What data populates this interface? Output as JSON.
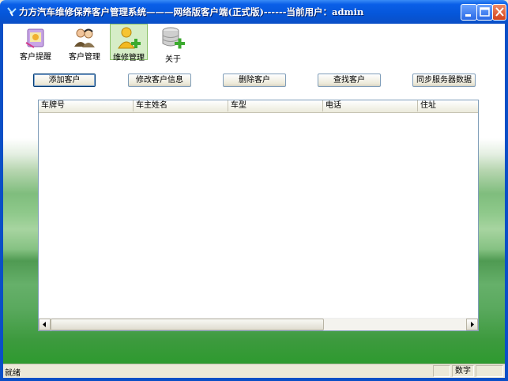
{
  "window": {
    "title": "力方汽车维修保养客户管理系统———网络版客户端(正式版)------当前用户：admin"
  },
  "toolbar": {
    "items": [
      {
        "label": "客户提醒",
        "icon": "reminder-icon"
      },
      {
        "label": "客户管理",
        "icon": "customers-icon"
      },
      {
        "label": "维修管理",
        "icon": "add-user-icon",
        "active": true
      },
      {
        "label": "关于",
        "icon": "database-add-icon"
      }
    ]
  },
  "actions": {
    "add_label": "添加客户",
    "edit_label": "修改客户信息",
    "delete_label": "删除客户",
    "find_label": "查找客户",
    "sync_label": "同步服务器数据"
  },
  "table": {
    "columns": [
      "车牌号",
      "车主姓名",
      "车型",
      "电话",
      "住址"
    ],
    "rows": []
  },
  "statusbar": {
    "text": "就绪",
    "mode": "数字"
  },
  "colors": {
    "title_bar": "#0556d9",
    "close_button": "#d2421b",
    "active_tool_bg": "#d6edc7"
  }
}
